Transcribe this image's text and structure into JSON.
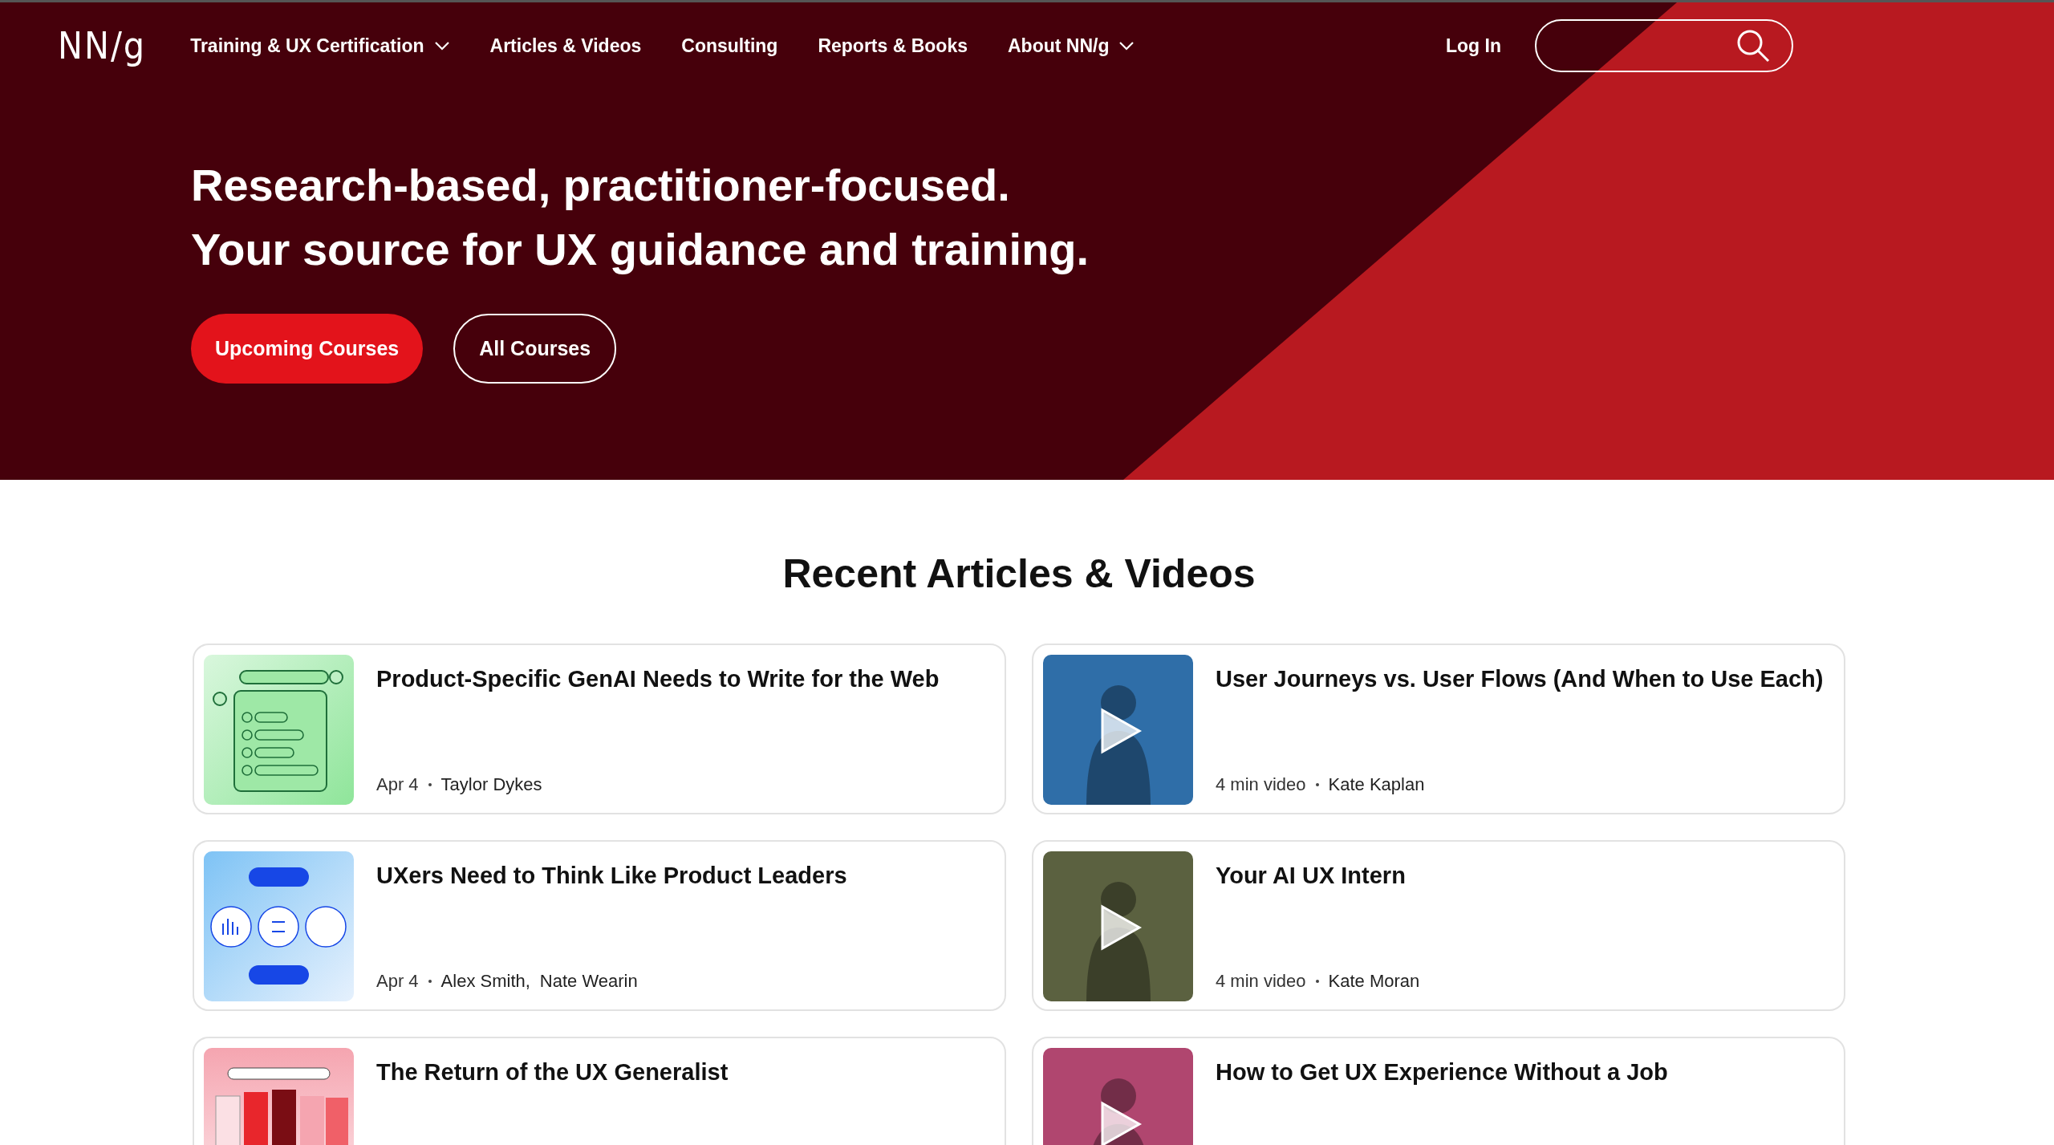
{
  "header": {
    "logo": "NN/g",
    "nav": [
      {
        "label": "Training & UX Certification",
        "dropdown": true
      },
      {
        "label": "Articles & Videos",
        "dropdown": false
      },
      {
        "label": "Consulting",
        "dropdown": false
      },
      {
        "label": "Reports & Books",
        "dropdown": false
      },
      {
        "label": "About NN/g",
        "dropdown": true
      }
    ],
    "login": "Log In"
  },
  "hero": {
    "headline": [
      "Research-based, practitioner-focused.",
      "Your source for UX guidance and training."
    ],
    "buttons": [
      {
        "label": "Upcoming Courses",
        "kind": "primary"
      },
      {
        "label": "All Courses",
        "kind": "outline"
      }
    ]
  },
  "section": {
    "title": "Recent Articles & Videos",
    "cards": [
      {
        "title": "Product-Specific GenAI Needs to Write for the Web",
        "meta": "Apr 4",
        "authors": [
          "Taylor Dykes"
        ],
        "thumbnail": {
          "kind": "checklist"
        }
      },
      {
        "title": "User Journeys vs. User Flows (And When to Use Each)",
        "meta": "4 min video",
        "authors": [
          "Kate Kaplan"
        ],
        "thumbnail": {
          "kind": "video",
          "color": "#2f6ea8"
        }
      },
      {
        "title": "UXers Need to Think Like Product Leaders",
        "meta": "Apr 4",
        "authors": [
          "Alex Smith,",
          "Nate Wearin"
        ],
        "thumbnail": {
          "kind": "diagram"
        }
      },
      {
        "title": "Your AI UX Intern",
        "meta": "4 min video",
        "authors": [
          "Kate Moran"
        ],
        "thumbnail": {
          "kind": "video",
          "color": "#5b6140"
        }
      },
      {
        "title": "The Return of the UX Generalist",
        "thumbnail": {
          "kind": "blocks"
        }
      },
      {
        "title": "How to Get UX Experience Without a Job",
        "thumbnail": {
          "kind": "video",
          "color": "#b0466f"
        }
      }
    ]
  }
}
